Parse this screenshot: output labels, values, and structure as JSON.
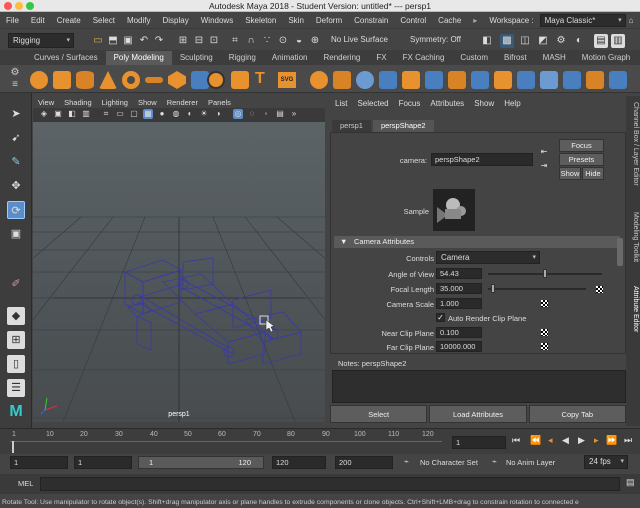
{
  "window": {
    "title": "Autodesk Maya 2018 - Student Version: untitled*   ---   persp1",
    "colors": {
      "close": "#fc5753",
      "min": "#fdbc40",
      "max": "#33c748"
    }
  },
  "menubar": {
    "items": [
      "File",
      "Edit",
      "Create",
      "Select",
      "Modify",
      "Display",
      "Windows",
      "Skeleton",
      "Skin",
      "Deform",
      "Constrain",
      "Control",
      "Cache"
    ],
    "workspace_label": "Workspace :",
    "workspace_value": "Maya Classic*"
  },
  "status_line": {
    "mode": "Rigging",
    "live_surface": "No Live Surface",
    "symmetry": "Symmetry: Off",
    "icons": [
      "folder-icon",
      "save-icon",
      "undo-icon",
      "redo-icon",
      "select-hierarchy-icon",
      "select-object-icon",
      "select-component-icon",
      "snap-grid-icon",
      "snap-curve-icon",
      "snap-point-icon",
      "snap-surface-icon",
      "render-icon",
      "ipr-icon",
      "render-settings-icon"
    ]
  },
  "shelf": {
    "tabs": [
      "Curves / Surfaces",
      "Poly Modeling",
      "Sculpting",
      "Rigging",
      "Animation",
      "Rendering",
      "FX",
      "FX Caching",
      "Custom",
      "Bifrost",
      "MASH",
      "Motion Graph"
    ],
    "active_tab": "Poly Modeling",
    "text_icon": "T",
    "svg_icon": "SVG",
    "accent": "#e8912f"
  },
  "viewport": {
    "menus": [
      "View",
      "Shading",
      "Lighting",
      "Show",
      "Renderer",
      "Panels"
    ],
    "camera_label": "persp1",
    "wire_color": "#3a3aa8"
  },
  "attribute_editor": {
    "menus": [
      "List",
      "Selected",
      "Focus",
      "Attributes",
      "Show",
      "Help"
    ],
    "tabs": [
      "persp1",
      "perspShape2"
    ],
    "active_tab": "perspShape2",
    "camera_label": "camera:",
    "camera_value": "perspShape2",
    "focus": "Focus",
    "presets": "Presets",
    "show": "Show",
    "hide": "Hide",
    "sample_label": "Sample",
    "section": "Camera Attributes",
    "fields": {
      "controls_label": "Controls",
      "controls_value": "Camera",
      "aov_label": "Angle of View",
      "aov_value": "54.43",
      "aov_level": 0.5,
      "focal_label": "Focal Length",
      "focal_value": "35.000",
      "focal_level": 0.03,
      "scale_label": "Camera Scale",
      "scale_value": "1.000",
      "auto_clip_label": "Auto Render Clip Plane",
      "auto_clip_checked": true,
      "near_label": "Near Clip Plane",
      "near_value": "0.100",
      "far_label": "Far Clip Plane",
      "far_value": "10000.000"
    },
    "notes_label": "Notes:  perspShape2",
    "buttons": [
      "Select",
      "Load Attributes",
      "Copy Tab"
    ]
  },
  "side_tabs": [
    "Channel Box / Layer Editor",
    "Modeling Toolkit",
    "Attribute Editor"
  ],
  "timeslider": {
    "ticks": [
      "1",
      "10",
      "20",
      "30",
      "40",
      "50",
      "60",
      "70",
      "80",
      "90",
      "100",
      "110",
      "120"
    ],
    "current_frame": "1"
  },
  "range": {
    "start": "1",
    "anim_start": "1",
    "inner_start": "1",
    "inner_end": "120",
    "anim_end": "120",
    "end": "200",
    "character_set": "No Character Set",
    "anim_layer": "No Anim Layer",
    "fps": "24 fps"
  },
  "command_line": {
    "label": "MEL"
  },
  "help_line": "Rotate Tool: Use manipulator to rotate object(s). Shift+drag manipulator axis or plane handles to extrude components or clone objects. Ctrl+Shift+LMB+drag to constrain rotation to connected e"
}
